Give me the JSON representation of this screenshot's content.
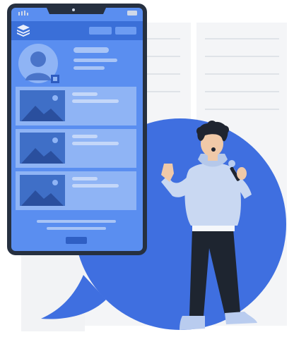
{
  "illustration": {
    "subject": "singer",
    "icons": [
      "layers-icon",
      "battery-icon",
      "signal-icon",
      "image-placeholder-icon",
      "microphone-icon"
    ]
  },
  "colors": {
    "accent_blue": "#4a7fe6",
    "bubble_blue": "#3f6fe0",
    "phone_frame": "#263040",
    "screen_blue": "#5a8ef0",
    "card_blue": "#8fb4f5",
    "hoodie": "#c9d8f2",
    "pants": "#1e2530",
    "skin": "#f0c9a8",
    "hair": "#1f2430",
    "shelf_gray": "#eef0f3"
  },
  "phone": {
    "list_rows": 3
  }
}
